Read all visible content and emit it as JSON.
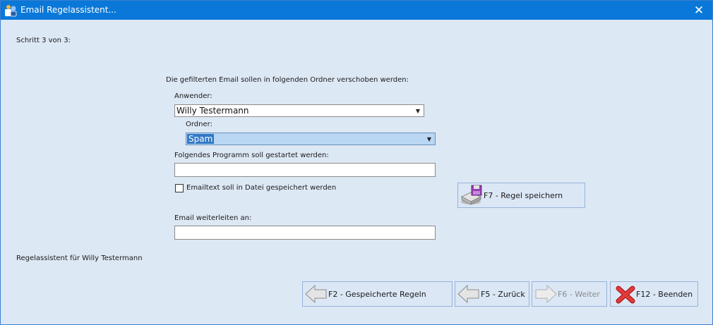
{
  "window": {
    "title": "Email Regelassistent...",
    "close_glyph": "✕"
  },
  "step_label": "Schritt 3 von 3:",
  "instruction": "Die gefilterten Email sollen in folgenden Ordner verschoben werden:",
  "user": {
    "label": "Anwender:",
    "value": "Willy Testermann"
  },
  "folder": {
    "label": "Ordner:",
    "value": "Spam"
  },
  "program": {
    "label": "Folgendes Programm soll gestartet werden:",
    "value": ""
  },
  "save_text_checkbox": {
    "label": "Emailtext soll in Datei gespeichert werden",
    "checked": false
  },
  "forward": {
    "label": "Email weiterleiten an:",
    "value": ""
  },
  "save_rule_button": {
    "label": "F7 - Regel speichern",
    "icon": "save-disk-icon"
  },
  "footer_status": "Regelassistent für Willy Testermann",
  "nav": {
    "saved_rules": {
      "label": "F2 - Gespeicherte Regeln",
      "icon": "arrow-left-icon"
    },
    "back": {
      "label": "F5 - Zurück",
      "icon": "arrow-left-icon"
    },
    "next": {
      "label": "F6 - Weiter",
      "icon": "arrow-right-icon",
      "disabled": true
    },
    "quit": {
      "label": "F12 - Beenden",
      "icon": "red-x-icon"
    }
  },
  "colors": {
    "titlebar": "#0a78d8",
    "background": "#dde8f5",
    "button": "#dbe7f5",
    "selection": "#3178c6"
  }
}
